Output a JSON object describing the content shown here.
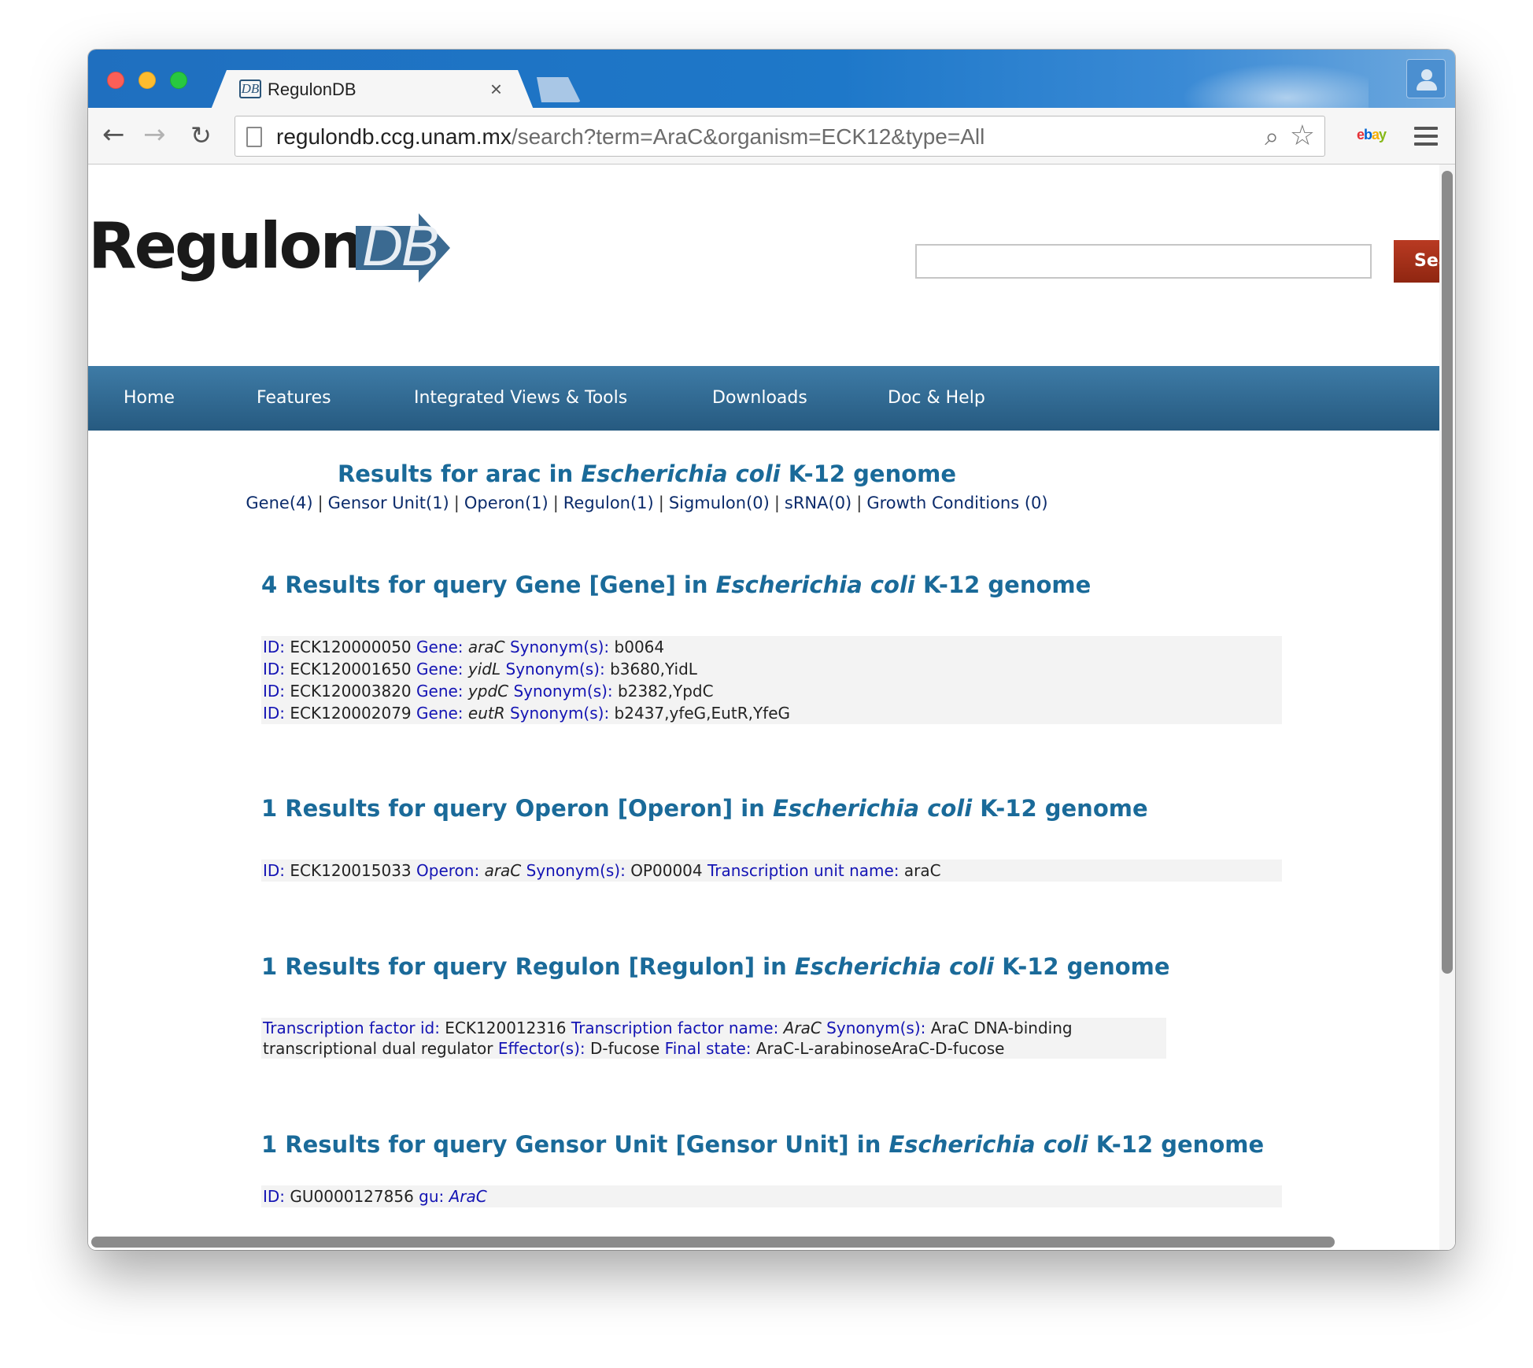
{
  "browser": {
    "tab_title": "RegulonDB",
    "tab_favicon": "DB",
    "tab_close": "×",
    "url_host": "regulondb.ccg.unam.mx",
    "url_path": "/search?term=AraC&organism=ECK12&type=All",
    "ebay": {
      "e": "e",
      "b": "b",
      "a": "a",
      "y": "y"
    }
  },
  "header": {
    "logo_text": "Regulon",
    "logo_db": "DB",
    "search_button": "Sear",
    "search_value": ""
  },
  "nav": {
    "home": "Home",
    "features": "Features",
    "integrated": "Integrated Views & Tools",
    "downloads": "Downloads",
    "doc": "Doc & Help"
  },
  "summary": {
    "title_pre": "Results for arac in ",
    "title_org": "Escherichia coli",
    "title_post": " K-12 genome",
    "links": [
      "Gene(4)",
      "Gensor Unit(1)",
      "Operon(1)",
      "Regulon(1)",
      "Sigmulon(0)",
      "sRNA(0)",
      "Growth Conditions (0)"
    ],
    "separator": "|"
  },
  "gene_section": {
    "title_pre": "4 Results for query Gene [Gene] in ",
    "title_org": "Escherichia coli",
    "title_post": " K-12 genome",
    "label_id": "ID:",
    "label_gene": "Gene:",
    "label_syn": "Synonym(s):",
    "rows": [
      {
        "id": "ECK120000050",
        "gene": "araC",
        "synonyms": "b0064"
      },
      {
        "id": "ECK120001650",
        "gene": "yidL",
        "synonyms": "b3680,YidL"
      },
      {
        "id": "ECK120003820",
        "gene": "ypdC",
        "synonyms": "b2382,YpdC"
      },
      {
        "id": "ECK120002079",
        "gene": "eutR",
        "synonyms": "b2437,yfeG,EutR,YfeG"
      }
    ]
  },
  "operon_section": {
    "title_pre": "1 Results for query Operon [Operon] in ",
    "title_org": "Escherichia coli",
    "title_post": " K-12 genome",
    "label_id": "ID:",
    "id": "ECK120015033",
    "label_operon": "Operon:",
    "operon": "araC",
    "label_syn": "Synonym(s):",
    "synonyms": "OP00004",
    "label_tu": "Transcription unit name:",
    "tu_name": "araC"
  },
  "regulon_section": {
    "title_pre": "1 Results for query Regulon [Regulon] in ",
    "title_org": "Escherichia coli",
    "title_post": " K-12 genome",
    "label_tf_id": "Transcription factor id:",
    "tf_id": "ECK120012316",
    "label_tf_name": "Transcription factor name:",
    "tf_name": "AraC",
    "label_syn": "Synonym(s):",
    "synonyms": "AraC DNA-binding transcriptional dual regulator",
    "label_effector": "Effector(s):",
    "effector": "D-fucose",
    "label_final": "Final state:",
    "final_state": "AraC-L-arabinoseAraC-D-fucose"
  },
  "gensor_section": {
    "title_pre": "1 Results for query Gensor Unit [Gensor Unit] in ",
    "title_org": "Escherichia coli",
    "title_post": " K-12 genome",
    "label_id": "ID:",
    "id": "GU0000127856",
    "label_gu": "gu:",
    "gu": "AraC"
  }
}
